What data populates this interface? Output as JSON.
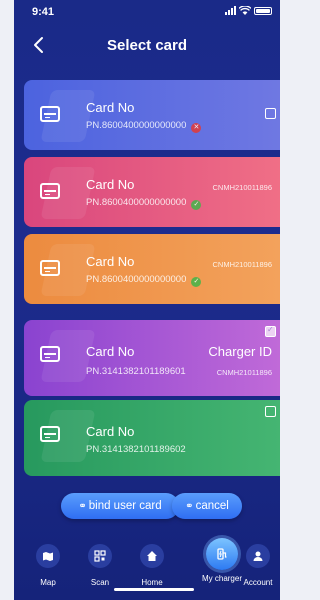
{
  "status_bar": {
    "time": "9:41"
  },
  "header": {
    "title": "Select card"
  },
  "cards": [
    {
      "title": "Card No",
      "number": "PN.8600400000000000",
      "status": "error",
      "station_id": "",
      "charger_label": "",
      "checked": false
    },
    {
      "title": "Card No",
      "number": "PN.8600400000000000",
      "status": "ok",
      "station_id": "CNMH210011896",
      "charger_label": "",
      "checked": false
    },
    {
      "title": "Card No",
      "number": "PN.8600400000000000",
      "status": "ok",
      "station_id": "CNMH210011896",
      "charger_label": "",
      "checked": false
    },
    {
      "title": "Card No",
      "number": "PN.3141382101189601",
      "status": "",
      "station_id": "CNMH21011896",
      "charger_label": "Charger ID",
      "checked": true
    },
    {
      "title": "Card No",
      "number": "PN.3141382101189602",
      "status": "",
      "station_id": "",
      "charger_label": "",
      "checked": false
    }
  ],
  "actions": {
    "bind_label": "bind user card",
    "cancel_label": "cancel",
    "icon": "link-icon"
  },
  "tab_bar": {
    "items": [
      {
        "label": "Map",
        "icon": "map-icon"
      },
      {
        "label": "Scan",
        "icon": "qr-scan-icon"
      },
      {
        "label": "Home",
        "icon": "home-icon"
      },
      {
        "label": "My charger",
        "icon": "charger-icon",
        "active": true
      },
      {
        "label": "Account",
        "icon": "account-icon"
      }
    ]
  },
  "colors": {
    "background": "#1d2c8e",
    "card_blue": "#5b6de0",
    "card_pink": "#e85a82",
    "card_orange": "#f0974c",
    "card_purple": "#a355d4",
    "card_green": "#36a768",
    "button_blue": "#3f82f5",
    "status_error": "#e53935",
    "status_ok": "#43b649"
  }
}
